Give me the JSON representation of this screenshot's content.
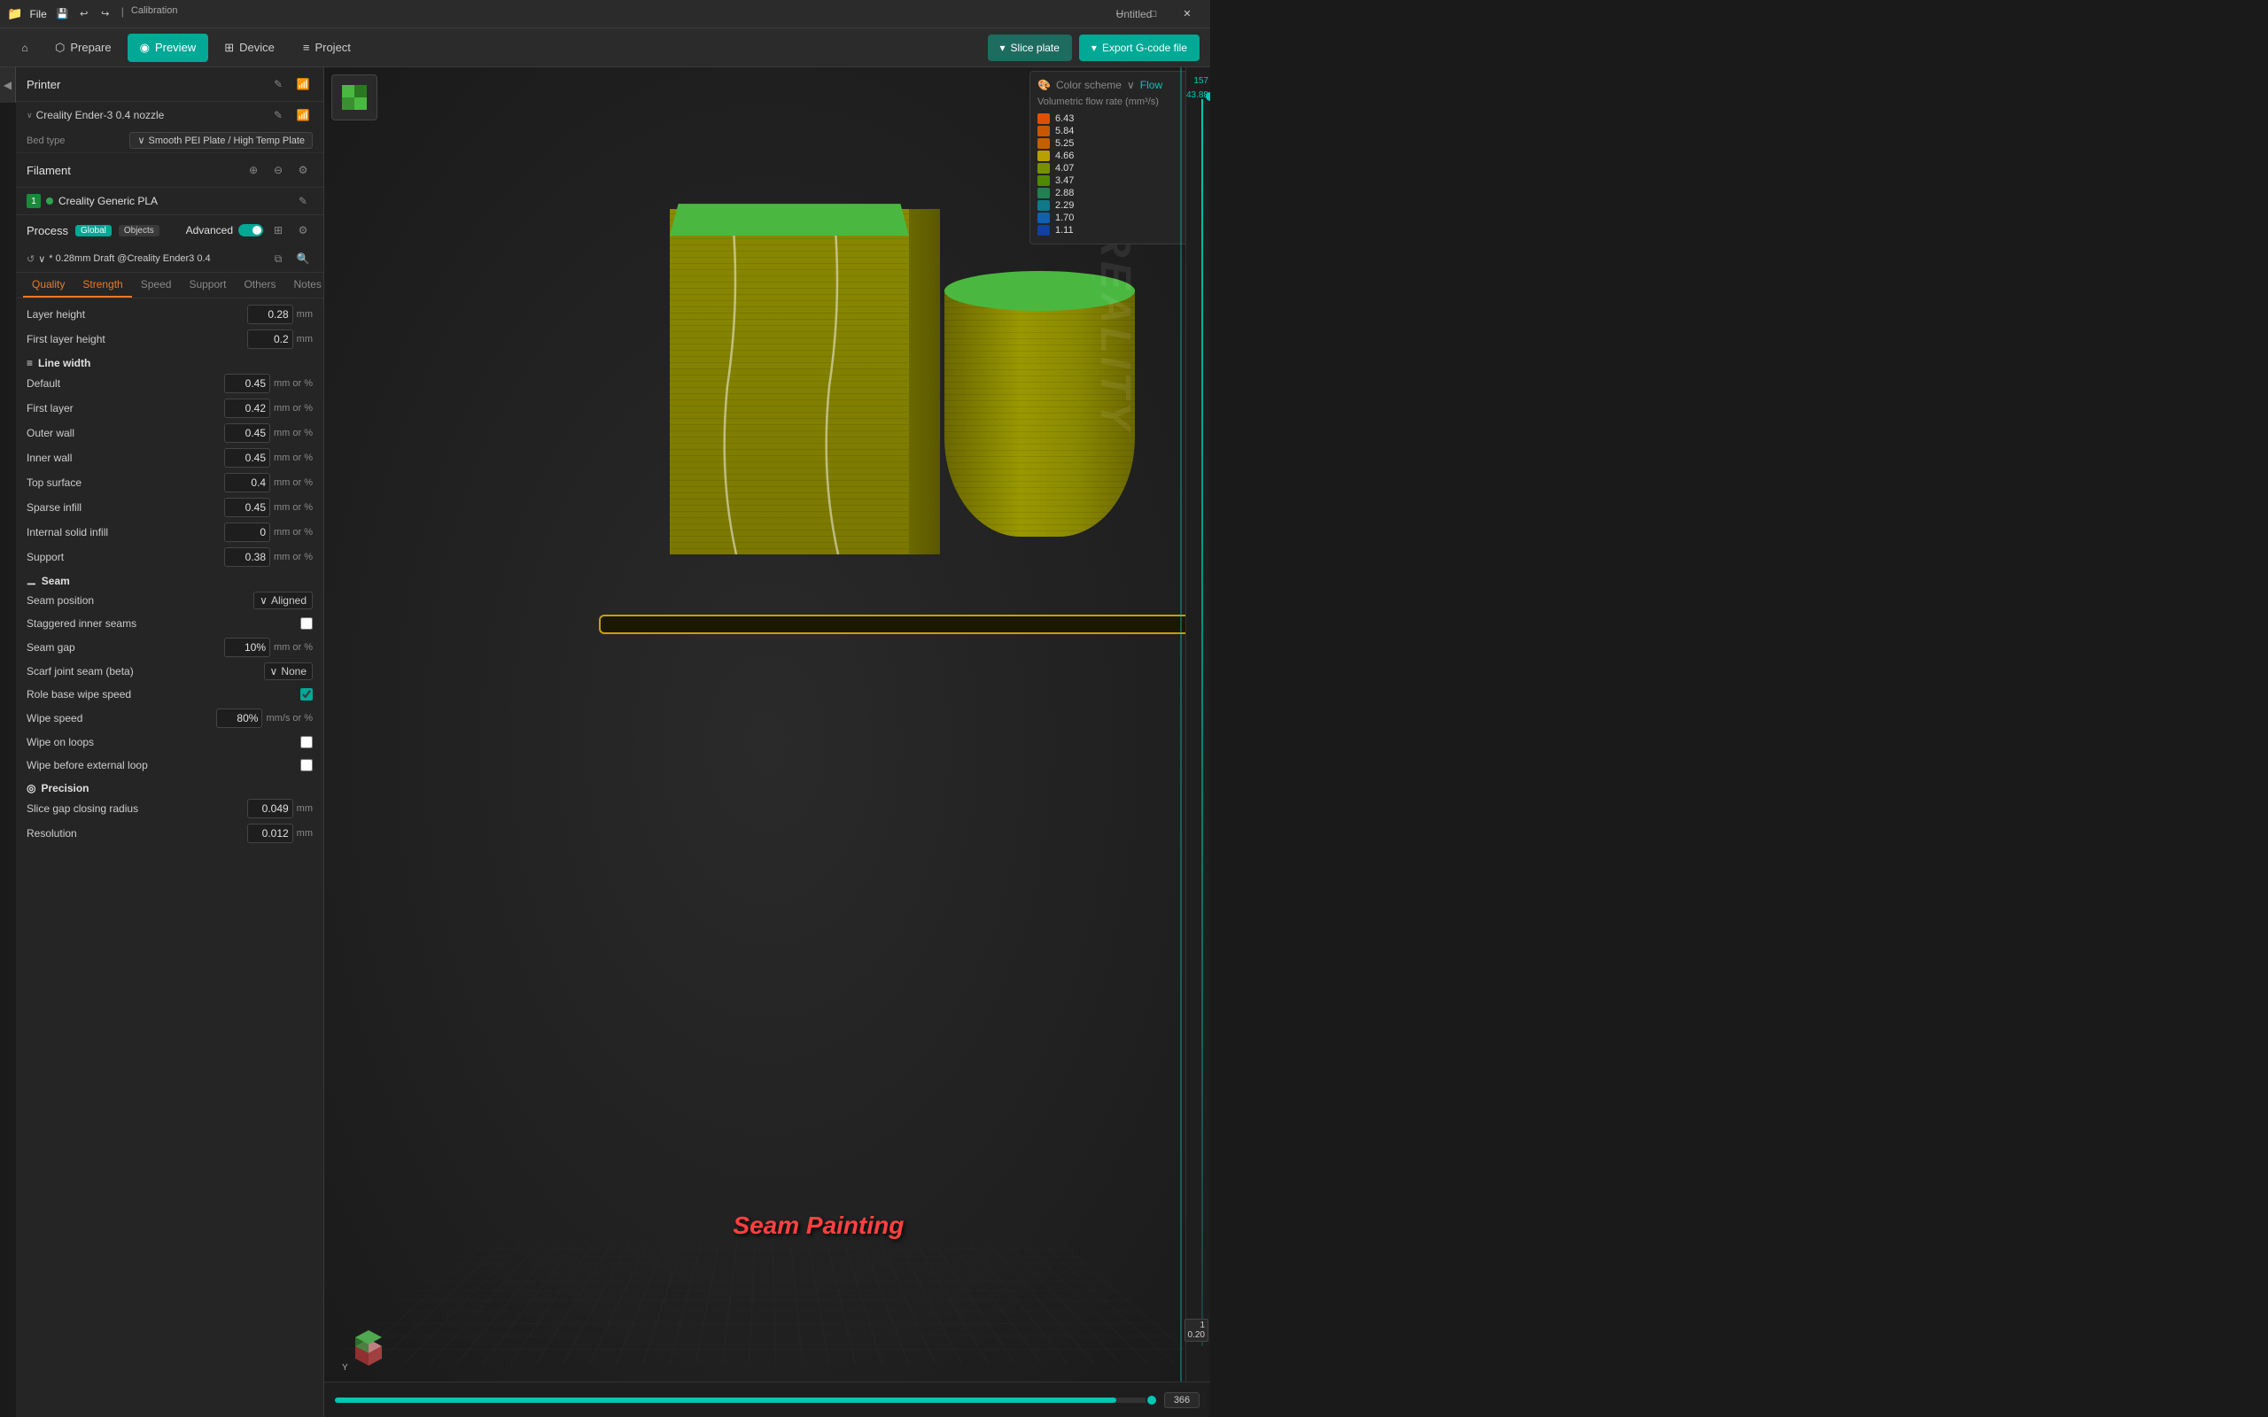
{
  "titleBar": {
    "appName": "File",
    "title": "Untitled",
    "windowControls": {
      "minimize": "─",
      "maximize": "□",
      "close": "✕"
    },
    "toolbarButtons": [
      "save-icon",
      "undo-icon",
      "redo-icon"
    ],
    "calibration": "Calibration"
  },
  "topNav": {
    "tabs": [
      {
        "id": "prepare",
        "label": "Prepare",
        "icon": "⬡",
        "active": false
      },
      {
        "id": "preview",
        "label": "Preview",
        "icon": "◉",
        "active": true
      },
      {
        "id": "device",
        "label": "Device",
        "icon": "⊞",
        "active": false
      },
      {
        "id": "project",
        "label": "Project",
        "icon": "≡",
        "active": false
      }
    ],
    "sliceButton": "Slice plate",
    "exportButton": "Export G-code file"
  },
  "leftPanel": {
    "printer": {
      "title": "Printer",
      "name": "Creality Ender-3 0.4 nozzle",
      "bedType": {
        "label": "Bed type",
        "value": "Smooth PEI Plate / High Temp Plate"
      }
    },
    "filament": {
      "title": "Filament",
      "items": [
        {
          "index": "1",
          "name": "Creality Generic PLA"
        }
      ]
    },
    "process": {
      "title": "Process",
      "tags": [
        "Global",
        "Objects"
      ],
      "advancedLabel": "Advanced",
      "profileName": "* 0.28mm Draft @Creality Ender3 0.4"
    },
    "settingsTabs": [
      {
        "id": "quality",
        "label": "Quality",
        "active": true,
        "highlight": true
      },
      {
        "id": "strength",
        "label": "Strength",
        "active": false,
        "highlight": true
      },
      {
        "id": "speed",
        "label": "Speed",
        "active": false
      },
      {
        "id": "support",
        "label": "Support",
        "active": false
      },
      {
        "id": "others",
        "label": "Others",
        "active": false
      },
      {
        "id": "notes",
        "label": "Notes",
        "active": false
      }
    ],
    "settings": {
      "layerHeight": {
        "label": "Layer height",
        "value": "0.28",
        "unit": "mm"
      },
      "firstLayerHeight": {
        "label": "First layer height",
        "value": "0.2",
        "unit": "mm"
      },
      "lineWidth": {
        "title": "Line width",
        "default": {
          "label": "Default",
          "value": "0.45",
          "unit": "mm or %"
        },
        "firstLayer": {
          "label": "First layer",
          "value": "0.42",
          "unit": "mm or %"
        },
        "outerWall": {
          "label": "Outer wall",
          "value": "0.45",
          "unit": "mm or %"
        },
        "innerWall": {
          "label": "Inner wall",
          "value": "0.45",
          "unit": "mm or %"
        },
        "topSurface": {
          "label": "Top surface",
          "value": "0.4",
          "unit": "mm or %"
        },
        "sparseInfill": {
          "label": "Sparse infill",
          "value": "0.45",
          "unit": "mm or %"
        },
        "internalSolid": {
          "label": "Internal solid infill",
          "value": "0",
          "unit": "mm or %"
        },
        "support": {
          "label": "Support",
          "value": "0.38",
          "unit": "mm or %"
        }
      },
      "seam": {
        "title": "Seam",
        "position": {
          "label": "Seam position",
          "value": "Aligned"
        },
        "staggered": {
          "label": "Staggered inner seams",
          "checked": false
        },
        "gap": {
          "label": "Seam gap",
          "value": "10%",
          "unit": "mm or %"
        },
        "scarfJoint": {
          "label": "Scarf joint seam (beta)",
          "value": "None"
        },
        "roleBaseWipe": {
          "label": "Role base wipe speed",
          "checked": true
        },
        "wipeSpeed": {
          "label": "Wipe speed",
          "value": "80%",
          "unit": "mm/s or %"
        },
        "wipeOnLoops": {
          "label": "Wipe on loops",
          "checked": false
        },
        "wipeBeforeExternal": {
          "label": "Wipe before external loop",
          "checked": false
        }
      },
      "precision": {
        "title": "Precision",
        "sliceGapClosing": {
          "label": "Slice gap closing radius",
          "value": "0.049",
          "unit": "mm"
        },
        "resolution": {
          "label": "Resolution",
          "value": "0.012",
          "unit": "mm"
        }
      }
    }
  },
  "viewport": {
    "colorScheme": {
      "header": "Color scheme",
      "flow": "Flow",
      "subtitle": "Volumetric flow rate (mm³/s)",
      "entries": [
        {
          "value": "6.43",
          "color": "#e05000"
        },
        {
          "value": "5.84",
          "color": "#c85800"
        },
        {
          "value": "5.25",
          "color": "#c06000"
        },
        {
          "value": "4.66",
          "color": "#b8a000"
        },
        {
          "value": "4.07",
          "color": "#789000"
        },
        {
          "value": "3.47",
          "color": "#508800"
        },
        {
          "value": "2.88",
          "color": "#208050"
        },
        {
          "value": "2.29",
          "color": "#107888"
        },
        {
          "value": "1.70",
          "color": "#1060b0"
        },
        {
          "value": "1.11",
          "color": "#1040a0"
        }
      ]
    },
    "seamPaintingLabel": "Seam Painting",
    "rulerTop": "157",
    "rulerTop2": "43.88",
    "rulerBottom": "1",
    "rulerBottom2": "0.20",
    "progressValue": "366"
  }
}
